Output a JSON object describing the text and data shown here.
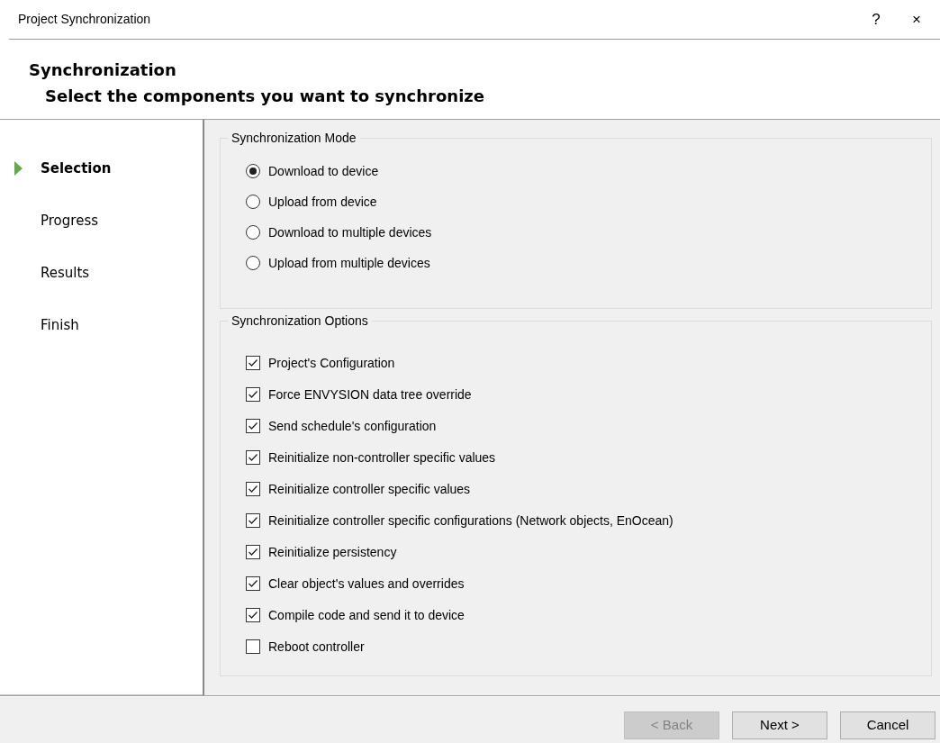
{
  "window": {
    "title": "Project Synchronization",
    "help": "?",
    "close": "×"
  },
  "header": {
    "title": "Synchronization",
    "subtitle": "Select the components you want to synchronize"
  },
  "steps": [
    {
      "label": "Selection",
      "selected": true
    },
    {
      "label": "Progress",
      "selected": false
    },
    {
      "label": "Results",
      "selected": false
    },
    {
      "label": "Finish",
      "selected": false
    }
  ],
  "mode": {
    "legend": "Synchronization Mode",
    "options": [
      {
        "label": "Download to device",
        "selected": true
      },
      {
        "label": "Upload from device",
        "selected": false
      },
      {
        "label": "Download to multiple devices",
        "selected": false
      },
      {
        "label": "Upload from multiple devices",
        "selected": false
      }
    ]
  },
  "options": {
    "legend": "Synchronization Options",
    "items": [
      {
        "label": "Project's Configuration",
        "checked": true
      },
      {
        "label": "Force ENVYSION data tree override",
        "checked": true
      },
      {
        "label": "Send schedule's configuration",
        "checked": true
      },
      {
        "label": "Reinitialize non-controller specific values",
        "checked": true
      },
      {
        "label": "Reinitialize controller specific values",
        "checked": true
      },
      {
        "label": "Reinitialize controller specific configurations (Network objects, EnOcean)",
        "checked": true
      },
      {
        "label": "Reinitialize persistency",
        "checked": true
      },
      {
        "label": "Clear object's values and overrides",
        "checked": true
      },
      {
        "label": "Compile code and send it to device",
        "checked": true
      },
      {
        "label": "Reboot controller",
        "checked": false
      }
    ]
  },
  "buttons": [
    {
      "label": "< Back",
      "disabled": true
    },
    {
      "label": "Next >",
      "disabled": false
    },
    {
      "label": "Cancel",
      "disabled": false
    }
  ]
}
